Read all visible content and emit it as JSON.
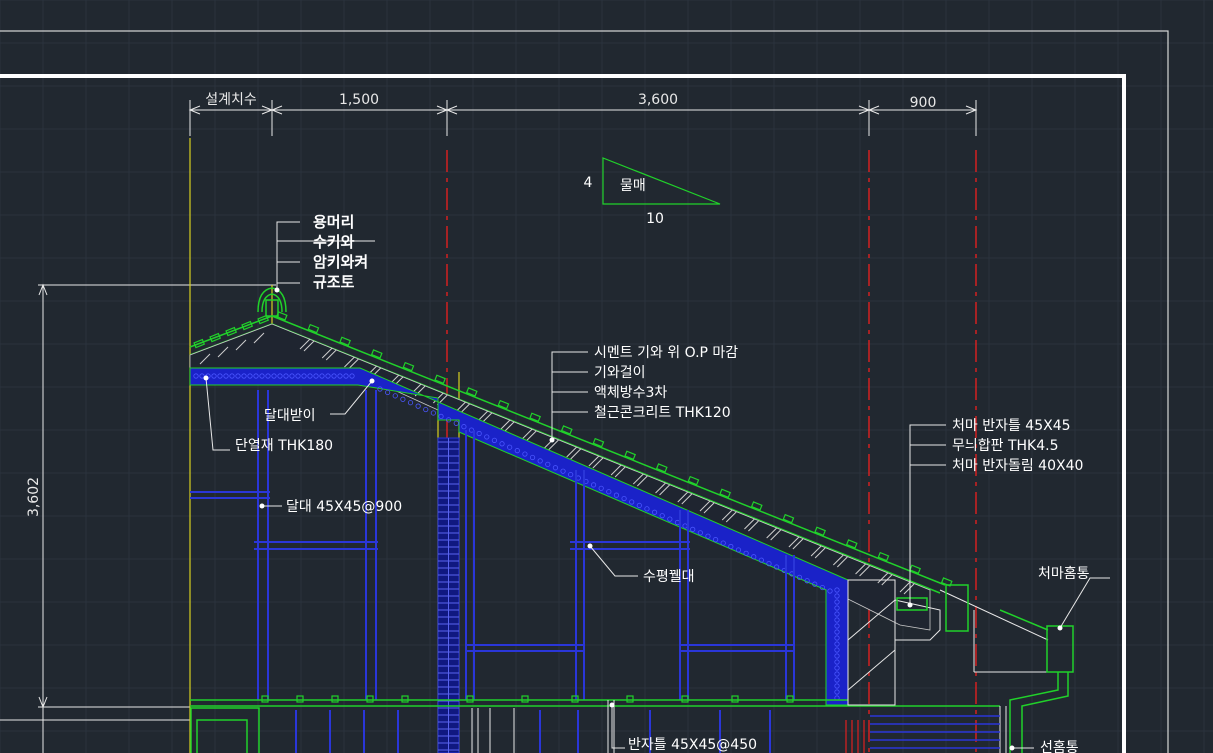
{
  "colors": {
    "background": "#212830",
    "grid": "#2c3440",
    "frame": "#e6e6e6",
    "line_white": "#e8e8e8",
    "roof_green": "#21d12a",
    "insulation_blue": "#1a22c8",
    "frame_blue": "#2a36d8",
    "centerline_red": "#e02020",
    "yellow": "#d8d020"
  },
  "dimensions": {
    "design": "설계치수",
    "d1": "1,500",
    "d2": "3,600",
    "d3": "900",
    "height": "3,602"
  },
  "slope": {
    "rise": "4",
    "run": "10",
    "label": "물매"
  },
  "ridge_labels": [
    "용머리",
    "수키와",
    "암키와켜",
    "규조토"
  ],
  "roof_layers": [
    "시멘트 기와 위 O.P 마감",
    "기와걸이",
    "액체방수3차",
    "철근콘크리트 THK120"
  ],
  "eave_labels": [
    "처마 반자틀 45X45",
    "무늬합판 THK4.5",
    "처마 반자돌림 40X40"
  ],
  "callouts": {
    "dalbat": "달대받이",
    "insulation": "단열재 THK180",
    "dalda": "달대 45X45@900",
    "horizontal": "수평꿸대",
    "gutter": "처마홈통",
    "ceiling": "반자틀 45X45@450",
    "downspout": "선홈통"
  }
}
